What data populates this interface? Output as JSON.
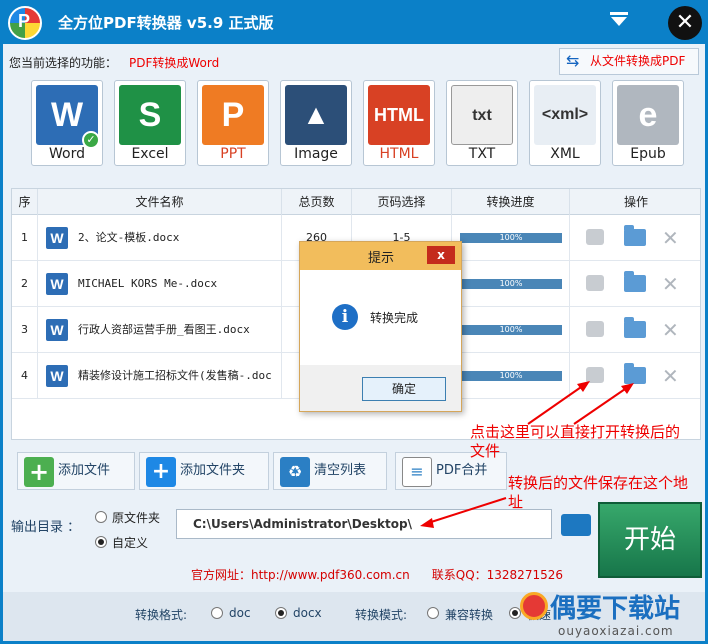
{
  "window": {
    "title": "全方位PDF转换器 v5.9 正式版"
  },
  "function_bar": {
    "label": "您当前选择的功能：",
    "value": "PDF转换成Word",
    "switch_button": "从文件转换成PDF"
  },
  "formats": [
    {
      "label": "Word",
      "icon": "word-icon",
      "color": "#2d6db5",
      "glyph": "W"
    },
    {
      "label": "Excel",
      "icon": "excel-icon",
      "color": "#1f9146",
      "glyph": "S"
    },
    {
      "label": "PPT",
      "icon": "ppt-icon",
      "color": "#ef7b23",
      "glyph": "P"
    },
    {
      "label": "Image",
      "icon": "image-icon",
      "color": "#2c4f78",
      "glyph": "▲"
    },
    {
      "label": "HTML",
      "icon": "html-icon",
      "color": "#d84124",
      "glyph": "HTML"
    },
    {
      "label": "TXT",
      "icon": "txt-icon",
      "color": "#eeeeee",
      "glyph": "txt"
    },
    {
      "label": "XML",
      "icon": "xml-icon",
      "color": "#e8eef4",
      "glyph": "xml"
    },
    {
      "label": "Epub",
      "icon": "epub-icon",
      "color": "#b0b7bf",
      "glyph": "e"
    }
  ],
  "table": {
    "headers": [
      "序",
      "文件名称",
      "总页数",
      "页码选择",
      "转换进度",
      "操作"
    ],
    "rows": [
      {
        "index": "1",
        "name": "2、论文-模板.docx",
        "pages": "260",
        "range": "1-5",
        "progress": "100%"
      },
      {
        "index": "2",
        "name": "MICHAEL KORS Me-.docx",
        "pages": "",
        "range": "",
        "progress": "100%"
      },
      {
        "index": "3",
        "name": "行政人资部运营手册_看图王.docx",
        "pages": "",
        "range": "",
        "progress": "100%"
      },
      {
        "index": "4",
        "name": "精装修设计施工招标文件(发售稿-.doc",
        "pages": "",
        "range": "",
        "progress": "100%"
      }
    ]
  },
  "dialog": {
    "title": "提示",
    "message": "转换完成",
    "ok": "确定",
    "close": "x"
  },
  "actions": {
    "add_file": "添加文件",
    "add_folder": "添加文件夹",
    "clear_list": "清空列表",
    "pdf_merge": "PDF合并"
  },
  "output": {
    "label": "输出目录 ：",
    "option_original": "原文件夹",
    "option_custom": "自定义",
    "path": "C:\\Users\\Administrator\\Desktop\\",
    "start": "开始"
  },
  "footer": {
    "website": "官方网址：http://www.pdf360.com.cn",
    "qq": "联系QQ：1328271526"
  },
  "bottom_bar": {
    "format_label": "转换格式:",
    "format_doc": "doc",
    "format_docx": "docx",
    "mode_label": "转换模式:",
    "mode_compat": "兼容转换",
    "mode_other": "极速"
  },
  "annotations": {
    "open_file_note_1": "点击这里可以直接打开转换后的",
    "open_file_note_2": "文件",
    "save_note_1": "转换后的文件保存在这个地",
    "save_note_2": "址"
  },
  "watermark": {
    "title": "偶要下载站",
    "subtitle": "ouyaoxiazai.com"
  }
}
